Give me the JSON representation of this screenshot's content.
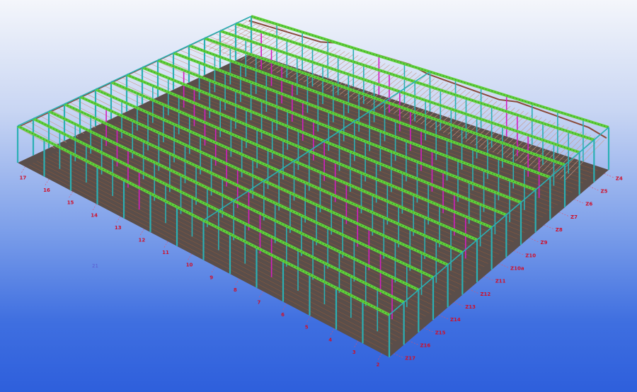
{
  "model": {
    "colors": {
      "background_top": "#f4f6fb",
      "background_bottom": "#2e5fdc",
      "floor": "#5a4e4a",
      "floor_hatch": "#c8642a",
      "column": "#2ab0b4",
      "column_secondary": "#d21fc0",
      "beam": "#5fd13a",
      "beam_web": "#3a7a2a",
      "roof_purlin": "#c89a8a",
      "roof_ridge": "#8a4a3a",
      "grid_line": "#e0506a",
      "grid_label": "#d0102a"
    },
    "left_axis_labels": [
      "17",
      "16",
      "15",
      "14",
      "13",
      "12",
      "11",
      "10",
      "9",
      "8",
      "7",
      "6",
      "5",
      "4",
      "3",
      "2"
    ],
    "right_axis_labels": [
      "Z4",
      "Z5",
      "Z6",
      "Z7",
      "Z8",
      "Z9",
      "Z10",
      "Z10a",
      "Z11",
      "Z12",
      "Z13",
      "Z14",
      "Z15",
      "Z16",
      "Z17"
    ],
    "stray_label": "21"
  }
}
